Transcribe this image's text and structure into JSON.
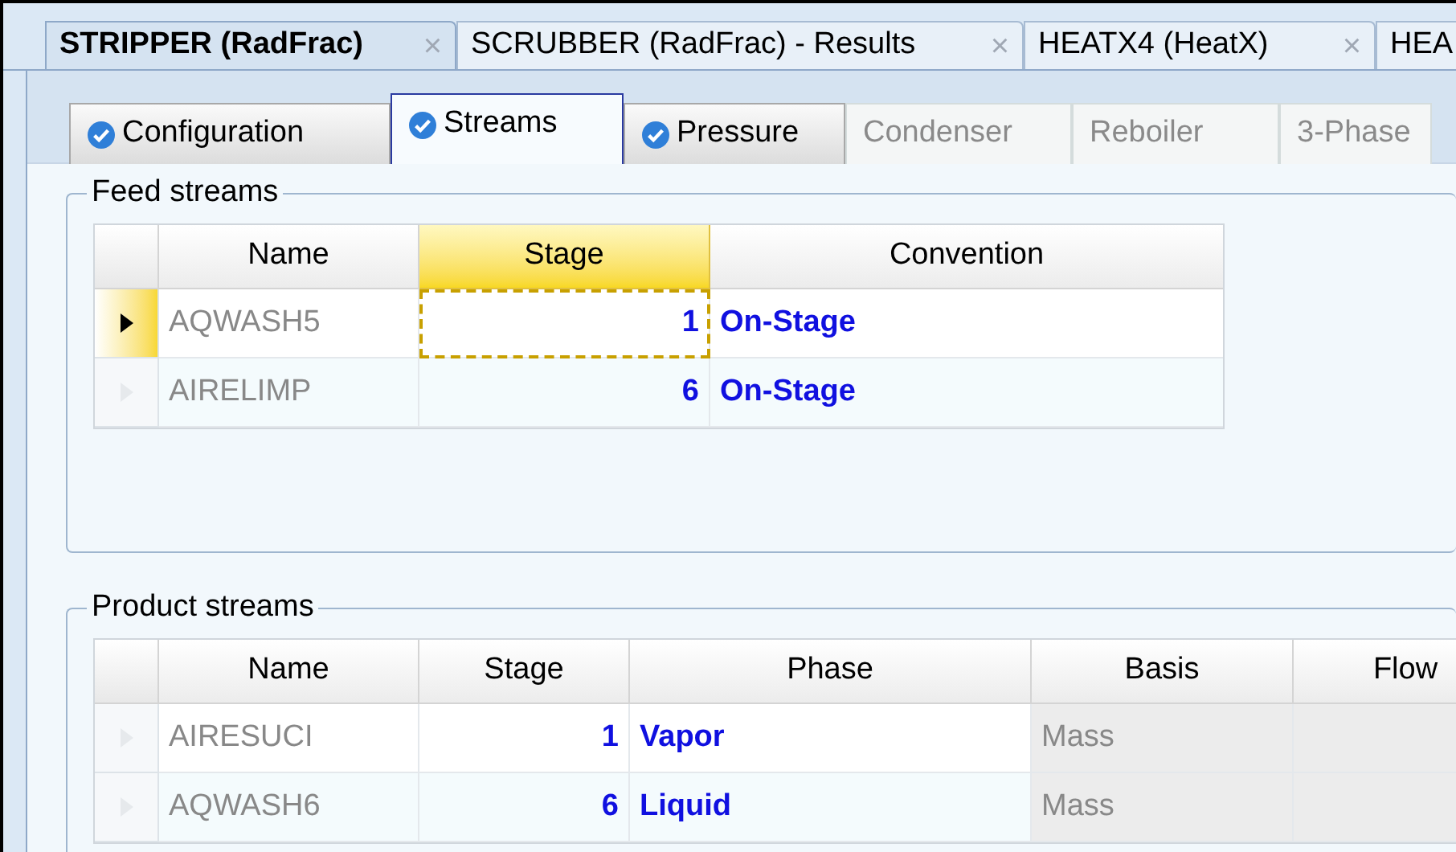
{
  "document_tabs": [
    {
      "label": "STRIPPER (RadFrac)",
      "selected": true,
      "closable": true
    },
    {
      "label": "SCRUBBER (RadFrac) - Results",
      "selected": false,
      "closable": true
    },
    {
      "label": "HEATX4 (HeatX)",
      "selected": false,
      "closable": true
    },
    {
      "label": "HEA",
      "selected": false
    }
  ],
  "close_glyph": "×",
  "form_tabs": [
    {
      "label": "Configuration",
      "selected": false,
      "complete": true,
      "disabled": false
    },
    {
      "label": "Streams",
      "selected": true,
      "complete": true,
      "disabled": false
    },
    {
      "label": "Pressure",
      "selected": false,
      "complete": true,
      "disabled": false
    },
    {
      "label": "Condenser",
      "selected": false,
      "complete": false,
      "disabled": true
    },
    {
      "label": "Reboiler",
      "selected": false,
      "complete": false,
      "disabled": true
    },
    {
      "label": "3-Phase",
      "selected": false,
      "complete": false,
      "disabled": true
    }
  ],
  "feed_streams": {
    "title": "Feed streams",
    "columns": [
      {
        "label": "Name",
        "selected": false
      },
      {
        "label": "Stage",
        "selected": true
      },
      {
        "label": "Convention",
        "selected": false
      }
    ],
    "rows": [
      {
        "current": true,
        "name": "AQWASH5",
        "stage": "1",
        "stage_focused": true,
        "convention": "On-Stage"
      },
      {
        "current": false,
        "name": "AIRELIMP",
        "stage": "6",
        "stage_focused": false,
        "convention": "On-Stage"
      }
    ]
  },
  "product_streams": {
    "title": "Product streams",
    "columns": [
      {
        "label": "Name",
        "selected": false
      },
      {
        "label": "Stage",
        "selected": false
      },
      {
        "label": "Phase",
        "selected": false
      },
      {
        "label": "Basis",
        "selected": false
      },
      {
        "label": "Flow",
        "selected": false
      }
    ],
    "rows": [
      {
        "current": false,
        "name": "AIRESUCI",
        "stage": "1",
        "phase": "Vapor",
        "basis": "Mass"
      },
      {
        "current": false,
        "name": "AQWASH6",
        "stage": "6",
        "phase": "Liquid",
        "basis": "Mass"
      }
    ]
  }
}
